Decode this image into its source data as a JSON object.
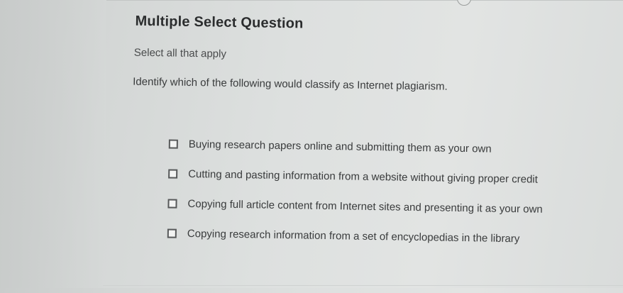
{
  "question": {
    "title": "Multiple Select Question",
    "instruction": "Select all that apply",
    "prompt": "Identify which of the following would classify as Internet plagiarism."
  },
  "options": [
    {
      "label": "Buying research papers online and submitting them as your own",
      "checked": false
    },
    {
      "label": "Cutting and pasting information from a website without giving proper credit",
      "checked": false
    },
    {
      "label": "Copying full article content from Internet sites and presenting it as your own",
      "checked": false
    },
    {
      "label": "Copying research information from a set of encyclopedias in the library",
      "checked": false
    }
  ]
}
